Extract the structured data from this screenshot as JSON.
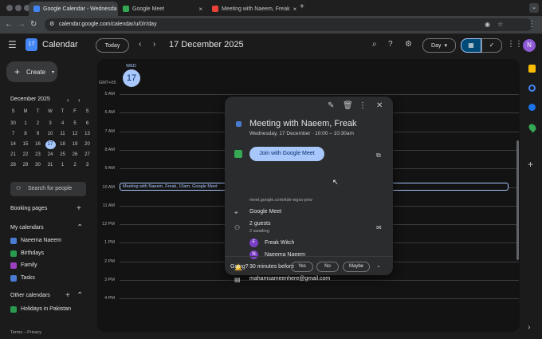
{
  "browser": {
    "tabs": [
      {
        "label": "Google Calendar - Wednesda",
        "close": "×"
      },
      {
        "label": "Google Meet",
        "close": "×"
      },
      {
        "label": "Meeting with Naeem, Freak",
        "close": "×"
      }
    ],
    "new_tab": "+",
    "url": "calendar.google.com/calendar/u/0/r/day",
    "profile_initial": "N"
  },
  "header": {
    "app_name": "Calendar",
    "today_label": "Today",
    "date_title": "17 December 2025",
    "view_label": "Day",
    "profile_initial": "N"
  },
  "sidebar": {
    "create_label": "Create",
    "month_title": "December 2025",
    "weekdays": [
      "S",
      "M",
      "T",
      "W",
      "T",
      "F",
      "S"
    ],
    "weeks": [
      [
        "30",
        "1",
        "2",
        "3",
        "4",
        "5",
        "6"
      ],
      [
        "7",
        "8",
        "9",
        "10",
        "11",
        "12",
        "13"
      ],
      [
        "14",
        "15",
        "16",
        "17",
        "18",
        "19",
        "20"
      ],
      [
        "21",
        "22",
        "23",
        "24",
        "25",
        "26",
        "27"
      ],
      [
        "28",
        "29",
        "30",
        "31",
        "1",
        "2",
        "3"
      ]
    ],
    "search_people": "Search for people",
    "booking_pages": "Booking pages",
    "my_calendars": "My calendars",
    "calendars": [
      {
        "label": "Naeema Naeem",
        "color": "#4a7bd0"
      },
      {
        "label": "Birthdays",
        "color": "#2a9a4e"
      },
      {
        "label": "Family",
        "color": "#9b40c0"
      },
      {
        "label": "Tasks",
        "color": "#4a7bd0"
      }
    ],
    "other_calendars": "Other calendars",
    "other": [
      {
        "label": "Holidays in Pakistan",
        "color": "#2a9a4e"
      }
    ],
    "footer": "Terms – Privacy"
  },
  "day": {
    "weekday": "WED",
    "date": "17",
    "timezone": "GMT+05",
    "hours": [
      "5 AM",
      "6 AM",
      "7 AM",
      "8 AM",
      "9 AM",
      "10 AM",
      "11 AM",
      "12 PM",
      "1 PM",
      "2 PM",
      "3 PM",
      "4 PM"
    ],
    "event_chip": "Meeting with Naeem, Freak, 10am, Google Meet"
  },
  "popup": {
    "title": "Meeting with Naeem, Freak",
    "when": "Wednesday, 17 December  ·  10:00 – 10:30am",
    "join_label": "Join with Google Meet",
    "meet_link": "meet.google.com/kde-wgxs-pnw",
    "location": "Google Meet",
    "guests_count": "2 guests",
    "guests_status": "2 awaiting",
    "guests": [
      {
        "initial": "F",
        "name": "Freak Witch"
      },
      {
        "initial": "N",
        "name": "Naeema Naeem"
      }
    ],
    "reminder": "30 minutes before",
    "organizer": "mahamsameenhere@gmail.com",
    "going_label": "Going?",
    "rsvp": [
      "Yes",
      "No",
      "Maybe"
    ]
  }
}
